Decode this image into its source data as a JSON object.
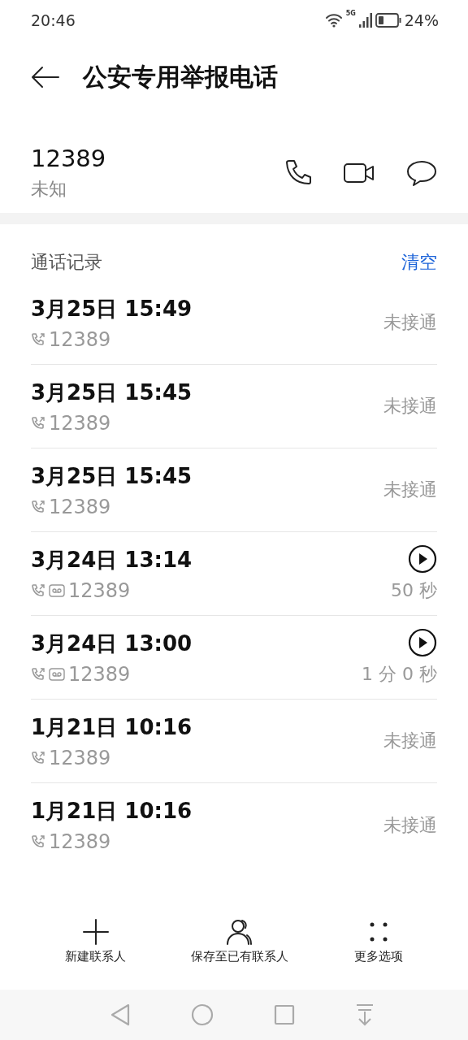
{
  "status_bar": {
    "time": "20:46",
    "network": "5G",
    "battery": "24%"
  },
  "header": {
    "title": "公安专用举报电话"
  },
  "contact": {
    "number": "12389",
    "label": "未知"
  },
  "call_log": {
    "title": "通话记录",
    "clear": "清空",
    "rows": [
      {
        "datetime": "3月25日 15:49",
        "number": "12389",
        "voicemail": false,
        "result": "未接通"
      },
      {
        "datetime": "3月25日 15:45",
        "number": "12389",
        "voicemail": false,
        "result": "未接通"
      },
      {
        "datetime": "3月25日 15:45",
        "number": "12389",
        "voicemail": false,
        "result": "未接通"
      },
      {
        "datetime": "3月24日 13:14",
        "number": "12389",
        "voicemail": true,
        "result": "50 秒"
      },
      {
        "datetime": "3月24日 13:00",
        "number": "12389",
        "voicemail": true,
        "result": "1 分 0 秒"
      },
      {
        "datetime": "1月21日 10:16",
        "number": "12389",
        "voicemail": false,
        "result": "未接通"
      },
      {
        "datetime": "1月21日 10:16",
        "number": "12389",
        "voicemail": false,
        "result": "未接通"
      }
    ]
  },
  "actions": [
    {
      "kind": "add",
      "label": "新建联系人"
    },
    {
      "kind": "save",
      "label": "保存至已有联系人"
    },
    {
      "kind": "more",
      "label": "更多选项"
    }
  ]
}
